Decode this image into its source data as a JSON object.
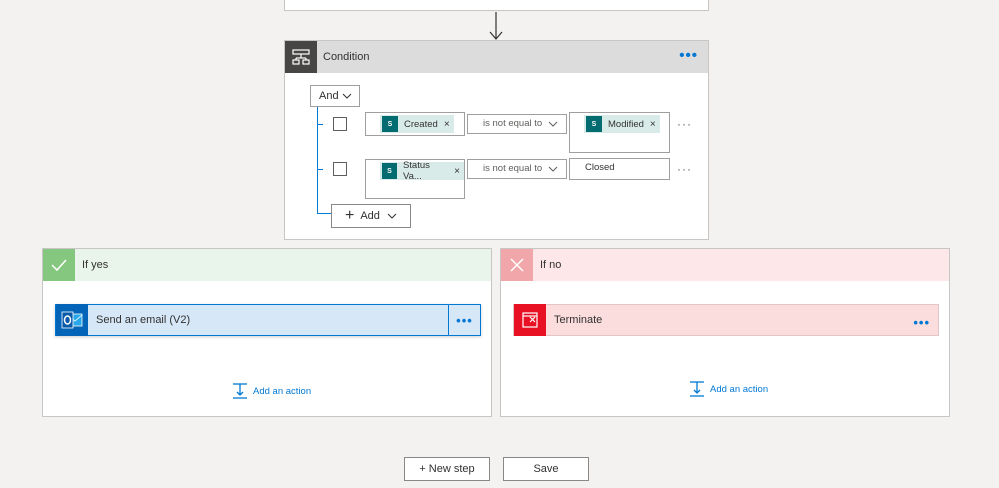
{
  "condition": {
    "title": "Condition",
    "group_operator": "And",
    "rows": [
      {
        "left_token": "Created",
        "operator": "is not equal to",
        "right_token": "Modified"
      },
      {
        "left_token": "Status Va...",
        "operator": "is not equal to",
        "right_value": "Closed"
      }
    ],
    "add_label": "Add"
  },
  "branches": {
    "yes": {
      "title": "If yes",
      "action_label": "Send an email (V2)",
      "add_action_label": "Add an action"
    },
    "no": {
      "title": "If no",
      "action_label": "Terminate",
      "add_action_label": "Add an action"
    }
  },
  "footer": {
    "new_step_label": "+ New step",
    "save_label": "Save"
  },
  "colors": {
    "accent": "#0078d4",
    "condition_header": "#dcdcdc",
    "condition_icon_bg": "#484644",
    "yes_header": "#e9f5ea",
    "yes_icon_bg": "#85c77f",
    "no_header": "#fde7e9",
    "no_icon_bg": "#f1a7a9",
    "outlook_blue": "#0364b8",
    "action_selected_bg": "#d6e7f7",
    "terminate_red": "#e81123",
    "terminate_bg": "#fbdddd",
    "sharepoint_teal": "#036c70"
  },
  "icons": [
    "condition-icon",
    "ellipsis-icon",
    "chevron-down-icon",
    "sharepoint-icon",
    "remove-token-icon",
    "plus-icon",
    "checkmark-icon",
    "x-icon",
    "outlook-icon",
    "terminate-icon",
    "add-action-icon",
    "down-arrow-icon"
  ]
}
